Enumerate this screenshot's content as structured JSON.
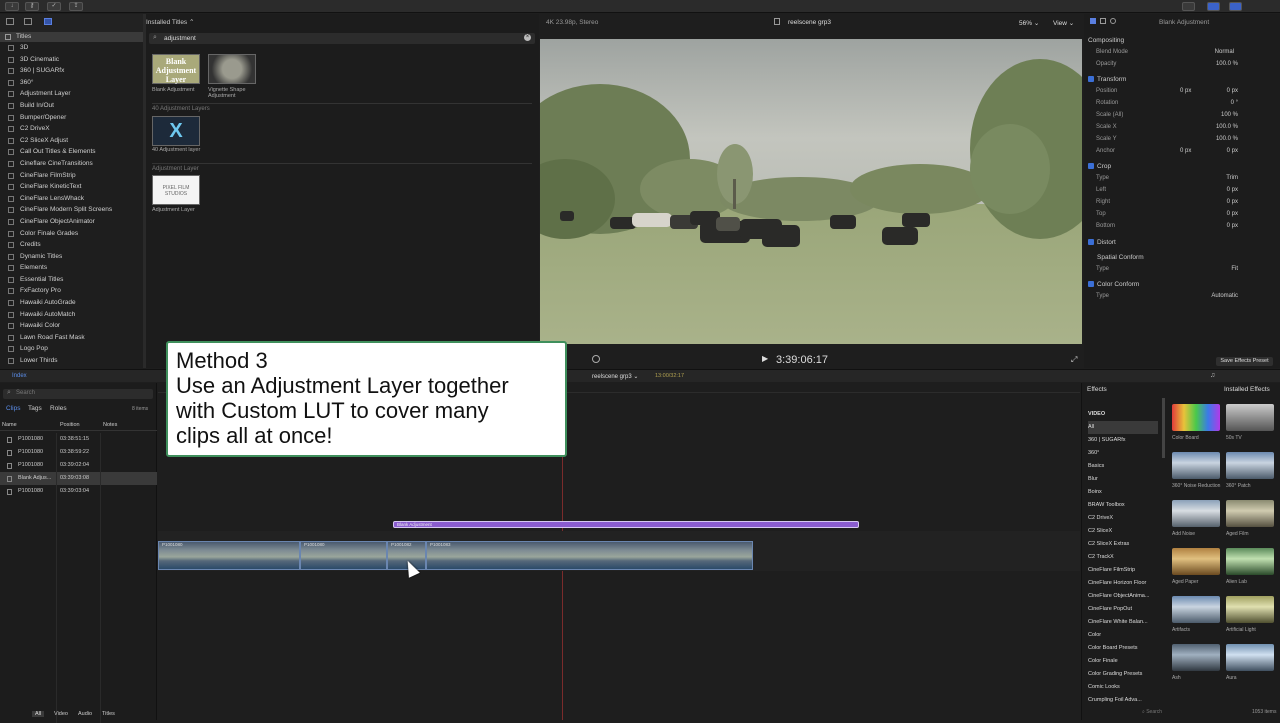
{
  "toolbar": {
    "icons": [
      "download-icon",
      "key-icon",
      "check-icon",
      "share-icon"
    ]
  },
  "titles_sidebar": {
    "header": "Titles",
    "items": [
      "3D",
      "3D Cinematic",
      "360 | SUGARfx",
      "360°",
      "Adjustment Layer",
      "Build In/Out",
      "Bumper/Opener",
      "C2 DriveX",
      "C2 SliceX Adjust",
      "Call Out Titles & Elements",
      "Cineflare CineTransitions",
      "CineFlare FilmStrip",
      "CineFlare KineticText",
      "CineFlare LensWhack",
      "CineFlare Modern Split Screens",
      "CineFlare ObjectAnimator",
      "Color Finale Grades",
      "Credits",
      "Dynamic Titles",
      "Elements",
      "Essential Titles",
      "FxFactory Pro",
      "Hawaiki AutoGrade",
      "Hawaiki AutoMatch",
      "Hawaiki Color",
      "Lawn Road Fast Mask",
      "Logo Pop",
      "Lower Thirds"
    ]
  },
  "title_browser": {
    "dropdown": "Installed Titles",
    "search_value": "adjustment",
    "items": [
      {
        "thumb_text": "Blank Adjustment Layer",
        "caption": "Blank Adjustment"
      },
      {
        "thumb_text": "",
        "caption": "Vignette Shape Adjustment"
      }
    ],
    "section2": "40 Adjustment Layers",
    "section2_caption": "40 Adjustment layer",
    "section3": "Adjustment Layer",
    "section3_thumb": "PIXEL FILM STUDIOS",
    "section3_caption": "Adjustment Layer"
  },
  "viewer": {
    "format": "4K 23.98p, Stereo",
    "clip_name": "reelscene grp3",
    "zoom": "56%",
    "view_label": "View",
    "timecode": "3:39:06:17"
  },
  "inspector": {
    "title": "Blank Adjustment",
    "compositing": "Compositing",
    "blend_mode_label": "Blend Mode",
    "blend_mode": "Normal",
    "opacity_label": "Opacity",
    "opacity": "100.0 %",
    "transform": "Transform",
    "position_label": "Position",
    "pos_x": "0 px",
    "pos_y": "0 px",
    "rotation_label": "Rotation",
    "rotation": "0 °",
    "scale_all_label": "Scale (All)",
    "scale_all": "100 %",
    "scale_x_label": "Scale X",
    "scale_x": "100.0 %",
    "scale_y_label": "Scale Y",
    "scale_y": "100.0 %",
    "anchor_label": "Anchor",
    "anchor_x": "0 px",
    "anchor_y": "0 px",
    "crop": "Crop",
    "type_label": "Type",
    "crop_type": "Trim",
    "left_label": "Left",
    "left": "0 px",
    "right_label": "Right",
    "right": "0 px",
    "top_label": "Top",
    "top": "0 px",
    "bottom_label": "Bottom",
    "bottom": "0 px",
    "distort": "Distort",
    "spatial_conform": "Spatial Conform",
    "spatial_type": "Fit",
    "color_conform": "Color Conform",
    "color_type": "Automatic",
    "save_button": "Save Effects Preset"
  },
  "timeline_index": {
    "tab": "Index",
    "search_placeholder": "Search",
    "tabs": [
      "Clips",
      "Tags",
      "Roles"
    ],
    "count": "8 items",
    "columns": [
      "Name",
      "Position",
      "Notes"
    ],
    "rows": [
      {
        "name": "P1001080",
        "pos": "03:38:51:15"
      },
      {
        "name": "P1001080",
        "pos": "03:38:59:22"
      },
      {
        "name": "P1001080",
        "pos": "03:39:02:04"
      },
      {
        "name": "Blank Adjus...",
        "pos": "03:39:03:08"
      },
      {
        "name": "P1001080",
        "pos": "03:39:03:04"
      }
    ],
    "bottom_tabs": [
      "All",
      "Video",
      "Audio",
      "Titles"
    ]
  },
  "timeline": {
    "project": "reelscene grp3",
    "duration": "13:00/32:17",
    "adjustment_clip": "Blank Adjustment",
    "clips": [
      "P1001080",
      "P1001080",
      "P1001082",
      "P1001083"
    ]
  },
  "effects": {
    "header": "Effects",
    "installed": "Installed Effects",
    "categories": [
      "VIDEO",
      "All",
      "360 | SUGARfx",
      "360°",
      "Basics",
      "Blur",
      "Boinx",
      "BRAW Toolbox",
      "C2 DriveX",
      "C2 SliceX",
      "C2 SliceX Extras",
      "C2 TrackX",
      "CineFlare FilmStrip",
      "CineFlare Horizon Floor",
      "CineFlare ObjectAnima...",
      "CineFlare PopOut",
      "CineFlare White Balan...",
      "Color",
      "Color Board Presets",
      "Color Finale",
      "Color Grading Presets",
      "Comic Looks",
      "Crumpling Foil Adva..."
    ],
    "items": [
      "Color Board",
      "50s TV",
      "360° Noise Reduction",
      "360° Patch",
      "Add Noise",
      "Aged Film",
      "Aged Paper",
      "Alien Lab",
      "Artifacts",
      "Artificial Light",
      "Ash",
      "Aura"
    ],
    "count": "1053 items",
    "search_placeholder": "Search"
  },
  "callout": {
    "line1": "Method 3",
    "line2": "Use an Adjustment Layer together",
    "line3": "with Custom LUT to cover many",
    "line4": "clips all at once!"
  }
}
